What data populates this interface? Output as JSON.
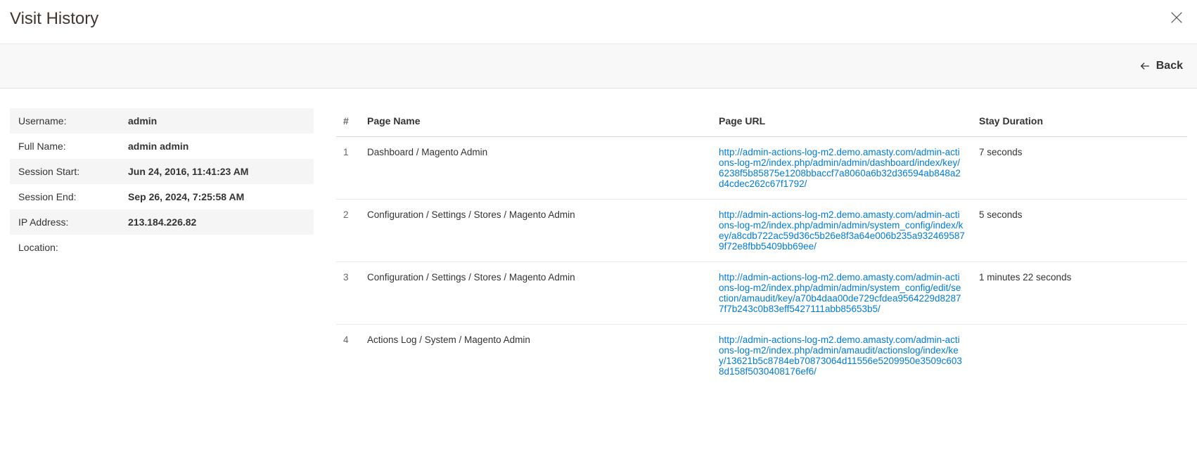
{
  "header": {
    "title": "Visit History"
  },
  "toolbar": {
    "back_label": "Back"
  },
  "info": {
    "rows": [
      {
        "label": "Username:",
        "value": "admin"
      },
      {
        "label": "Full Name:",
        "value": "admin admin"
      },
      {
        "label": "Session Start:",
        "value": "Jun 24, 2016, 11:41:23 AM"
      },
      {
        "label": "Session End:",
        "value": "Sep 26, 2024, 7:25:58 AM"
      },
      {
        "label": "IP Address:",
        "value": "213.184.226.82"
      },
      {
        "label": "Location:",
        "value": ""
      }
    ]
  },
  "table": {
    "columns": {
      "num": "#",
      "page_name": "Page Name",
      "page_url": "Page URL",
      "stay_duration": "Stay Duration"
    },
    "rows": [
      {
        "num": "1",
        "page_name": "Dashboard / Magento Admin",
        "page_url": "http://admin-actions-log-m2.demo.amasty.com/admin-actions-log-m2/index.php/admin/admin/dashboard/index/key/6238f5b85875e1208bbaccf7a8060a6b32d36594ab848a2d4cdec262c67f1792/",
        "stay_duration": "7 seconds"
      },
      {
        "num": "2",
        "page_name": "Configuration / Settings / Stores / Magento Admin",
        "page_url": "http://admin-actions-log-m2.demo.amasty.com/admin-actions-log-m2/index.php/admin/admin/system_config/index/key/a8cdb722ac59d36c5b26e8f3a64e006b235a9324695879f72e8fbb5409bb69ee/",
        "stay_duration": "5 seconds"
      },
      {
        "num": "3",
        "page_name": "Configuration / Settings / Stores / Magento Admin",
        "page_url": "http://admin-actions-log-m2.demo.amasty.com/admin-actions-log-m2/index.php/admin/admin/system_config/edit/section/amaudit/key/a70b4daa00de729cfdea9564229d82877f7b243c0b83eff5427111abb85653b5/",
        "stay_duration": "1 minutes 22 seconds"
      },
      {
        "num": "4",
        "page_name": "Actions Log / System / Magento Admin",
        "page_url": "http://admin-actions-log-m2.demo.amasty.com/admin-actions-log-m2/index.php/admin/amaudit/actionslog/index/key/13621b5c8784eb70873064d11556e5209950e3509c6038d158f5030408176ef6/",
        "stay_duration": ""
      }
    ]
  }
}
